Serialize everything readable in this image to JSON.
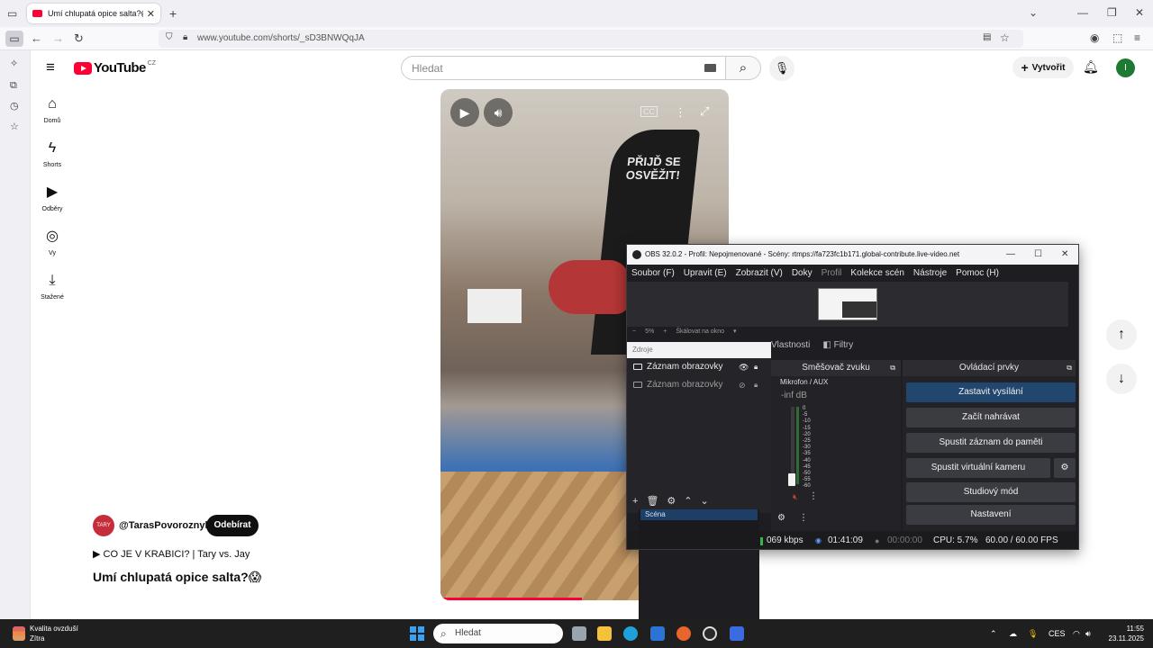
{
  "browser": {
    "tab_title": "Umí chlupatá opice salta?😱 - YouTube",
    "tab_close": "✕",
    "new_tab": "+",
    "url": "www.youtube.com/shorts/_sD3BNWQqJA"
  },
  "youtube": {
    "logo_text": "YouTube",
    "country_code": "CZ",
    "search_placeholder": "Hledat",
    "create_label": "Vytvořit",
    "avatar_initial": "I",
    "rail": [
      {
        "label": "Domů",
        "icon": "home-icon"
      },
      {
        "label": "Shorts",
        "icon": "shorts-icon"
      },
      {
        "label": "Odběry",
        "icon": "subscriptions-icon"
      },
      {
        "label": "Vy",
        "icon": "you-icon"
      },
      {
        "label": "Stažené",
        "icon": "downloads-icon"
      }
    ],
    "video_banner_text": "PŘIJĎ SE OSVĚŽIT!",
    "video_progress": 0.49,
    "channel_name": "@TarasPovoroznyk",
    "channel_avatar_text": "TARY",
    "subscribe_label": "Odebírat",
    "playlist_label": "▶ CO JE V KRABICI? | Tary vs. Jay",
    "video_title": "Umí chlupatá opice salta?😱"
  },
  "obs": {
    "title": "OBS 32.0.2 - Profil: Nepojmenované - Scény: rtmps://fa723fc1b171.global-contribute.live-video.net",
    "menu": [
      {
        "label": "Soubor (F)",
        "disabled": false
      },
      {
        "label": "Upravit (E)",
        "disabled": false
      },
      {
        "label": "Zobrazit (V)",
        "disabled": false
      },
      {
        "label": "Doky",
        "disabled": false
      },
      {
        "label": "Profil",
        "disabled": true
      },
      {
        "label": "Kolekce scén",
        "disabled": false
      },
      {
        "label": "Nástroje",
        "disabled": false
      },
      {
        "label": "Pomoc (H)",
        "disabled": false
      }
    ],
    "zoom_minus": "−",
    "zoom_value": "5%",
    "zoom_plus": "+",
    "zoom_mode": "Škálovat na okno",
    "tab_properties": "Vlastnosti",
    "tab_filters": "Filtry",
    "sources_header": "Zdroje",
    "sources": [
      {
        "name": "Záznam obrazovky",
        "visible": true
      },
      {
        "name": "Záznam obrazovky",
        "visible": false
      }
    ],
    "scene_name": "Scéna",
    "mixer_header": "Směšovač zvuku",
    "mixer_channel": "Mikrofon / AUX",
    "mixer_level": "-inf dB",
    "meter_ticks": [
      "0",
      "-5",
      "-10",
      "-15",
      "-20",
      "-25",
      "-30",
      "-35",
      "-40",
      "-45",
      "-50",
      "-55",
      "-60"
    ],
    "controls_header": "Ovládací prvky",
    "controls": [
      {
        "label": "Zastavit vysílání",
        "active": true
      },
      {
        "label": "Začít nahrávat",
        "active": false
      },
      {
        "label": "Spustit záznam do paměti",
        "active": false
      },
      {
        "label": "Spustit virtuální kameru",
        "active": false
      },
      {
        "label": "Studiový mód",
        "active": false
      },
      {
        "label": "Nastavení",
        "active": false
      }
    ],
    "status": {
      "bitrate": "069 kbps",
      "stream_time": "01:41:09",
      "record_time": "00:00:00",
      "cpu": "CPU: 5.7%",
      "fps": "60.00 / 60.00 FPS"
    }
  },
  "taskbar": {
    "weather_title": "Kvalita ovzduší",
    "weather_sub": "Zítra",
    "search_placeholder": "Hledat",
    "language": "CES",
    "time": "11:55",
    "date": "23.11.2025"
  }
}
